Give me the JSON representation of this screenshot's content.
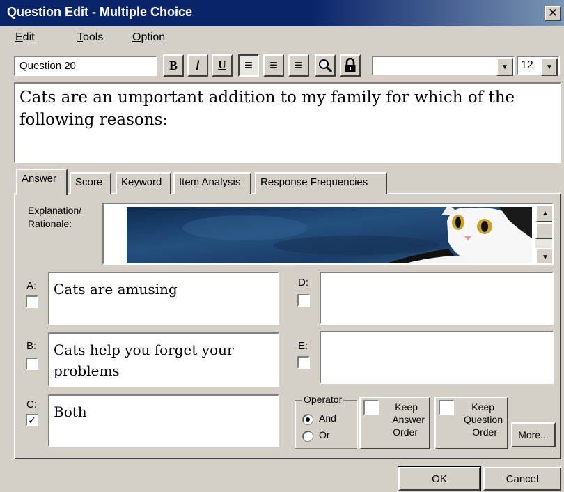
{
  "window": {
    "title": "Question Edit - Multiple Choice",
    "close_glyph": "✕"
  },
  "menu": {
    "edit": {
      "accel": "E",
      "rest": "dit"
    },
    "tools": {
      "accel": "T",
      "rest": "ools"
    },
    "option": {
      "accel": "O",
      "rest": "ption"
    }
  },
  "toolbar": {
    "question_name": "Question 20",
    "bold": "B",
    "italic": "/",
    "underline": "U",
    "align_left": "≡",
    "align_center": "≡",
    "align_right": "≡",
    "font_name": "",
    "font_size": "12",
    "dropdown_glyph": "▼"
  },
  "question_text": "Cats are an umportant addition to my family for which of the following reasons:",
  "tabs": [
    {
      "label": "Answer",
      "active": true
    },
    {
      "label": "Score"
    },
    {
      "label": "Keyword"
    },
    {
      "label": "Item Analysis"
    },
    {
      "label": "Response Frequencies"
    }
  ],
  "explanation": {
    "label_line1": "Explanation/",
    "label_line2": "Rationale:",
    "scroll_up": "▲",
    "scroll_down": "▼"
  },
  "options": {
    "a": {
      "letter": "A:",
      "text": "Cats are amusing",
      "checked": false
    },
    "b": {
      "letter": "B:",
      "text": "Cats help you forget your problems",
      "checked": false
    },
    "c": {
      "letter": "C:",
      "text": "Both",
      "checked": true,
      "check_glyph": "✓"
    },
    "d": {
      "letter": "D:",
      "text": "",
      "checked": false
    },
    "e": {
      "letter": "E:",
      "text": "",
      "checked": false
    }
  },
  "operator": {
    "legend": "Operator",
    "and_label": "And",
    "or_label": "Or",
    "selected": "And"
  },
  "keep_answer": {
    "line1": "Keep",
    "line2": "Answer",
    "line3": "Order",
    "checked": false
  },
  "keep_question": {
    "line1": "Keep",
    "line2": "Question",
    "line3": "Order",
    "checked": false
  },
  "buttons": {
    "more": "More...",
    "ok": "OK",
    "cancel": "Cancel"
  },
  "colors": {
    "titlebar": "#0a246a",
    "face": "#d4d0c8",
    "image_blue": "#1f3f66"
  }
}
